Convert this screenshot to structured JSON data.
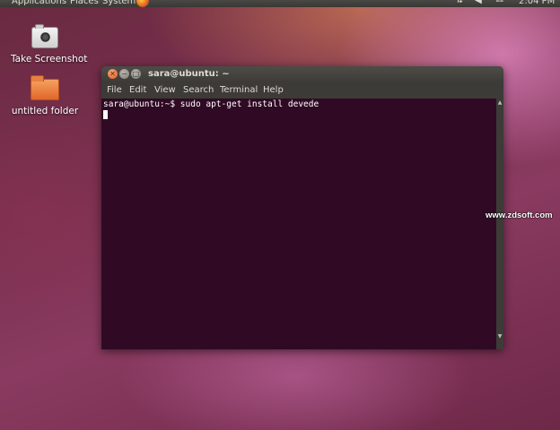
{
  "top_panel": {
    "menus": [
      "Applications",
      "Places",
      "System"
    ],
    "clock": "2:04 PM",
    "tray_icons": [
      "network-icon",
      "volume-icon",
      "mail-icon"
    ]
  },
  "desktop": {
    "icons": [
      {
        "label": "Take Screenshot",
        "icon": "camera-icon"
      },
      {
        "label": "untitled folder",
        "icon": "folder-icon"
      }
    ]
  },
  "terminal": {
    "title": "sara@ubuntu: ~",
    "menu": [
      "File",
      "Edit",
      "View",
      "Search",
      "Terminal",
      "Help"
    ],
    "lines": [
      "sara@ubuntu:~$ sudo apt-get install devede"
    ],
    "colors": {
      "background": "#300a24",
      "text": "#ffffff",
      "chrome": "#3c3b37"
    }
  },
  "watermark": "www.zdsoft.com"
}
